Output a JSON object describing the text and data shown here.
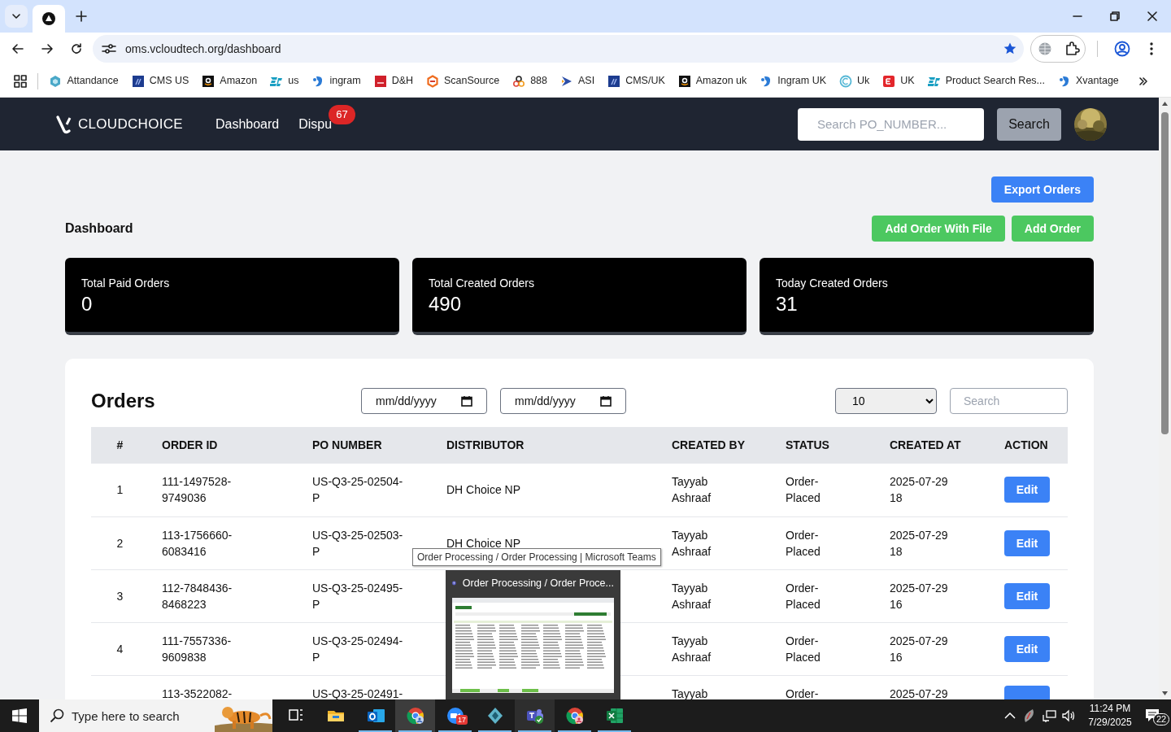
{
  "browser": {
    "url": "oms.vcloudtech.org/dashboard",
    "bookmarked": true,
    "bookmarks": [
      {
        "label": "Attandance",
        "kind": "hex"
      },
      {
        "label": "CMS US",
        "kind": "df"
      },
      {
        "label": "Amazon",
        "kind": "amazon"
      },
      {
        "label": "us",
        "kind": "ec"
      },
      {
        "label": "ingram",
        "kind": "ingram"
      },
      {
        "label": "D&H",
        "kind": "dh"
      },
      {
        "label": "ScanSource",
        "kind": "scan"
      },
      {
        "label": "888",
        "kind": "rings"
      },
      {
        "label": "ASI",
        "kind": "asi"
      },
      {
        "label": "CMS/UK",
        "kind": "df"
      },
      {
        "label": "Amazon uk",
        "kind": "amazon"
      },
      {
        "label": "Ingram UK",
        "kind": "ingram"
      },
      {
        "label": "Uk",
        "kind": "ring"
      },
      {
        "label": "UK",
        "kind": "ex"
      },
      {
        "label": "Product Search Res...",
        "kind": "ec"
      },
      {
        "label": "Xvantage",
        "kind": "ingram"
      }
    ]
  },
  "app": {
    "brand": "CLOUDCHOICE",
    "nav": [
      {
        "label": "Dashboard"
      },
      {
        "label": "Dispu",
        "badge": "67"
      }
    ],
    "search": {
      "placeholder": "Search PO_NUMBER..."
    },
    "search_button": "Search"
  },
  "page": {
    "export_button": "Export Orders",
    "heading": "Dashboard",
    "add_buttons": [
      "Add Order With File",
      "Add Order"
    ],
    "stats": [
      {
        "label": "Total Paid Orders",
        "value": "0"
      },
      {
        "label": "Total Created Orders",
        "value": "490"
      },
      {
        "label": "Today Created Orders",
        "value": "31"
      }
    ]
  },
  "orders": {
    "title": "Orders",
    "date_from": "mm/dd/yyyy",
    "date_to": "mm/dd/yyyy",
    "page_size": "10",
    "search": {
      "placeholder": "Search"
    },
    "columns": [
      "#",
      "ORDER ID",
      "PO NUMBER",
      "DISTRIBUTOR",
      "CREATED BY",
      "STATUS",
      "CREATED AT",
      "ACTION"
    ],
    "rows": [
      {
        "num": "1",
        "order_id": "111-1497528-9749036",
        "po_number": "US-Q3-25-02504-P",
        "distributor": "DH Choice NP",
        "created_by": "Tayyab Ashraaf",
        "status": "Order-Placed",
        "created_at": "2025-07-29 18",
        "action": "Edit"
      },
      {
        "num": "2",
        "order_id": "113-1756660-6083416",
        "po_number": "US-Q3-25-02503-P",
        "distributor": "DH Choice NP",
        "created_by": "Tayyab Ashraaf",
        "status": "Order-Placed",
        "created_at": "2025-07-29 18",
        "action": "Edit"
      },
      {
        "num": "3",
        "order_id": "112-7848436-8468223",
        "po_number": "US-Q3-25-02495-P",
        "created_by": "Tayyab Ashraaf",
        "status": "Order-Placed",
        "created_at": "2025-07-29 16",
        "action": "Edit"
      },
      {
        "num": "4",
        "order_id": "111-7557336-9609838",
        "po_number": "US-Q3-25-02494-P",
        "created_by": "Tayyab Ashraaf",
        "status": "Order-Placed",
        "created_at": "2025-07-29 16",
        "action": "Edit"
      },
      {
        "order_id": "113-3522082-",
        "po_number": "US-Q3-25-02491-",
        "created_by": "Tayyab",
        "status": "Order-",
        "created_at": "2025-07-29"
      }
    ]
  },
  "tooltip": "Order Processing / Order Processing | Microsoft Teams",
  "preview": {
    "title": "Order Processing / Order Proce..."
  },
  "taskbar": {
    "search": {
      "placeholder": "Type here to search"
    },
    "apps": [
      {
        "kind": "taskview",
        "selected": false,
        "hovered": false,
        "running": false
      },
      {
        "kind": "explorer",
        "selected": false,
        "hovered": false,
        "running": false
      },
      {
        "kind": "outlook",
        "selected": false,
        "hovered": false,
        "running": true
      },
      {
        "kind": "chrome",
        "selected": true,
        "hovered": false,
        "running": true
      },
      {
        "kind": "zoom",
        "selected": false,
        "hovered": false,
        "running": true,
        "badge": "17"
      },
      {
        "kind": "gem",
        "selected": false,
        "hovered": false,
        "running": true
      },
      {
        "kind": "teams",
        "selected": false,
        "hovered": true,
        "running": true
      },
      {
        "kind": "chrome_profile",
        "selected": false,
        "hovered": false,
        "running": true
      },
      {
        "kind": "excel",
        "selected": false,
        "hovered": false,
        "running": true
      }
    ],
    "time": "11:24 PM",
    "date": "7/29/2025",
    "notifications": "22"
  }
}
